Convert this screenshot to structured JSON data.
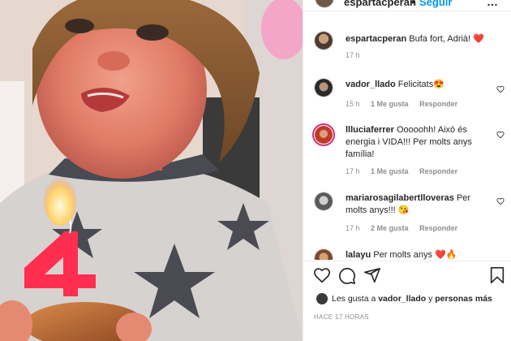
{
  "post": {
    "username": "espartacperan",
    "dot": "•",
    "follow_label": "Seguir",
    "more_label": "…"
  },
  "comments": [
    {
      "username": "espartacperan",
      "text": " Bufa fort, Adrià! ❤️",
      "time": "17 h",
      "likes": "",
      "reply": ""
    },
    {
      "username": "vador_llado",
      "text": " Felicitats😍",
      "time": "15 h",
      "likes": "1 Me gusta",
      "reply": "Responder"
    },
    {
      "username": "llluciaferrer",
      "text": " Ooooohh! Això és energia i VIDA!!! Per molts anys família!",
      "time": "17 h",
      "likes": "1 Me gusta",
      "reply": "Responder"
    },
    {
      "username": "mariarosagilabertlloveras",
      "text": " Per molts anys!!! 😘",
      "time": "17 h",
      "likes": "2 Me gusta",
      "reply": "Responder"
    },
    {
      "username": "lalayu",
      "text": " Per molts anys ❤️🔥",
      "time": "",
      "likes": "",
      "reply": ""
    }
  ],
  "likes_bar": {
    "prefix": "Les gusta a ",
    "user": "vador_llado",
    "middle": " y ",
    "others": "personas más"
  },
  "timestamp": "HACE 17 HORAS",
  "icons": {
    "like": "heart-icon",
    "comment": "comment-icon",
    "share": "paper-plane-icon",
    "save": "bookmark-icon"
  },
  "colors": {
    "follow": "#0095f6",
    "meta": "#8e8e8e",
    "story_ring": "#d62976",
    "candle": "#ff2e4f"
  }
}
